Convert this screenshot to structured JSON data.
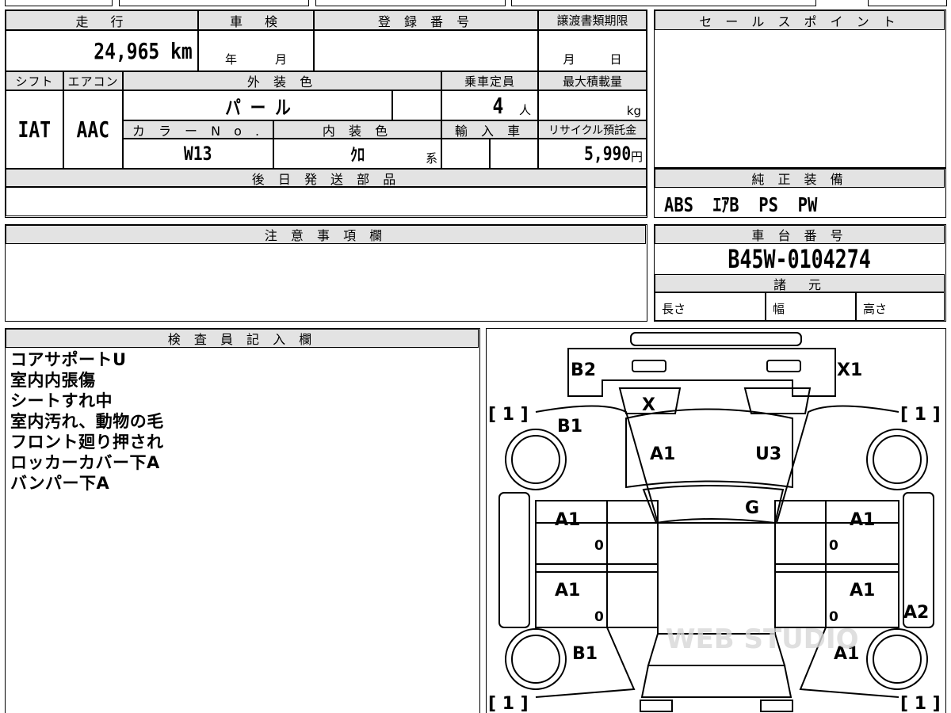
{
  "header": {
    "mileage_label": "走　行",
    "mileage_value": "24,965 km",
    "shaken_label": "車　検",
    "shaken_year": "年",
    "shaken_month": "月",
    "reg_label": "登 録 番 号",
    "transfer_label": "譲渡書類期限",
    "transfer_month": "月",
    "transfer_day": "日",
    "shift_label": "シフト",
    "shift_value": "IAT",
    "ac_label": "エアコン",
    "ac_value": "AAC",
    "exterior_label": "外 装 色",
    "exterior_value": "パ ー ル",
    "capacity_label": "乗車定員",
    "capacity_value": "4",
    "capacity_unit": "人",
    "maxload_label": "最大積載量",
    "maxload_unit": "kg",
    "color_no_label": "カ ラ ー N o .",
    "color_no_value": "W13",
    "interior_label": "内 装 色",
    "interior_value": "ｸﾛ",
    "interior_unit": "系",
    "import_label": "輸 入 車",
    "recycle_label": "リサイクル預託金",
    "recycle_value": "5,990",
    "recycle_unit": "円",
    "later_parts_label": "後 日 発 送 部 品"
  },
  "sales_point": {
    "label": "セ ー ル ス ポ イ ン ト"
  },
  "genuine_equipment": {
    "label": "純 正 装 備",
    "value": "ABS  ｴｱB  PS  PW"
  },
  "caution": {
    "label": "注 意 事 項 欄"
  },
  "chassis": {
    "label": "車 台 番 号",
    "value": "B45W-0104274"
  },
  "specs": {
    "label": "諸　元",
    "length": "長さ",
    "width": "幅",
    "height": "高さ"
  },
  "inspector": {
    "label": "検 査 員 記 入 欄",
    "notes": [
      "コアサポートU",
      "室内内張傷",
      "シートすれ中",
      "室内汚れ、動物の毛",
      "フロント廻り押され",
      "ロッカーカバー下A",
      "バンパー下A"
    ]
  },
  "diagram": {
    "codes": {
      "b2": "B2",
      "x1": "X1",
      "x": "X",
      "b1_front": "B1",
      "a1_hood": "A1",
      "u3": "U3",
      "g": "G",
      "a1_fl": "A1",
      "a1_fr": "A1",
      "a1_rl": "A1",
      "a1_rr": "A1",
      "a2": "A2",
      "b1_rear": "B1",
      "a1_rear": "A1"
    },
    "tires": {
      "fl": "[ 1 ]",
      "fr": "[ 1 ]",
      "rl": "[ 1 ]",
      "rr": "[ 1 ]"
    },
    "zeros": {
      "fl": "0",
      "fr": "0",
      "rl": "0",
      "rr": "0"
    },
    "watermark": "WEB STUDIO"
  }
}
